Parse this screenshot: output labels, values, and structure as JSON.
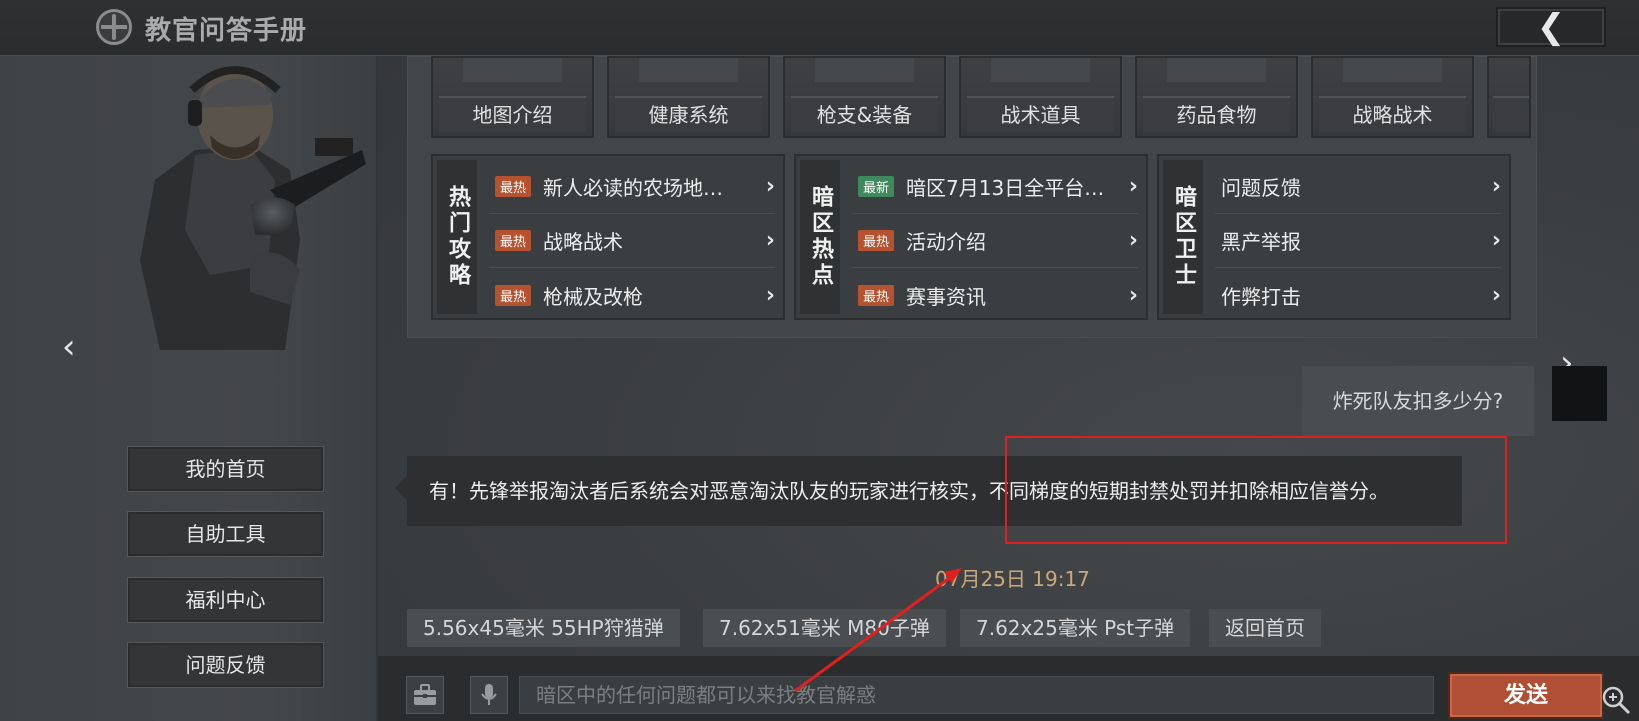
{
  "header": {
    "title": "教官问答手册",
    "back_icon": "chevron-left-icon"
  },
  "sidebar": {
    "prev_arrow": "‹",
    "menu": [
      {
        "label": "我的首页"
      },
      {
        "label": "自助工具"
      },
      {
        "label": "福利中心"
      },
      {
        "label": "问题反馈"
      }
    ]
  },
  "categories": [
    {
      "label": "地图介绍"
    },
    {
      "label": "健康系统"
    },
    {
      "label": "枪支&装备"
    },
    {
      "label": "战术道具"
    },
    {
      "label": "药品食物"
    },
    {
      "label": "战略战术"
    }
  ],
  "groups": [
    {
      "title": "热门攻略",
      "rows": [
        {
          "badge": "最热",
          "text": "新人必读的农场地…"
        },
        {
          "badge": "最热",
          "text": "战略战术"
        },
        {
          "badge": "最热",
          "text": "枪械及改枪"
        }
      ]
    },
    {
      "title": "暗区热点",
      "rows": [
        {
          "badge": "最新",
          "text": "暗区7月13日全平台…"
        },
        {
          "badge": "最热",
          "text": "活动介绍"
        },
        {
          "badge": "最热",
          "text": "赛事资讯"
        }
      ]
    },
    {
      "title": "暗区卫士",
      "rows": [
        {
          "text": "问题反馈"
        },
        {
          "text": "黑产举报"
        },
        {
          "text": "作弊打击"
        }
      ]
    }
  ],
  "chat": {
    "user_message": "炸死队友扣多少分?",
    "bot_message": "有！先锋举报淘汰者后系统会对恶意淘汰队友的玩家进行核实，不同梯度的短期封禁处罚并扣除相应信誉分。",
    "timestamp": "07月25日 19:17",
    "next_arrow": "›"
  },
  "quick_replies": [
    {
      "label": "5.56x45毫米 55HP狩猎弹"
    },
    {
      "label": "7.62x51毫米 M80子弹"
    },
    {
      "label": "7.62x25毫米 Pst子弹"
    },
    {
      "label": "返回首页"
    }
  ],
  "input": {
    "placeholder": "暗区中的任何问题都可以来找教官解惑",
    "send_label": "发送",
    "toolbox_icon": "toolbox-icon",
    "mic_icon": "microphone-icon"
  },
  "colors": {
    "badge_hot": "#b5522f",
    "badge_new": "#3f8a5c",
    "send_button": "#b04f35",
    "annotation": "#e02020",
    "timestamp": "#c9a97a"
  }
}
